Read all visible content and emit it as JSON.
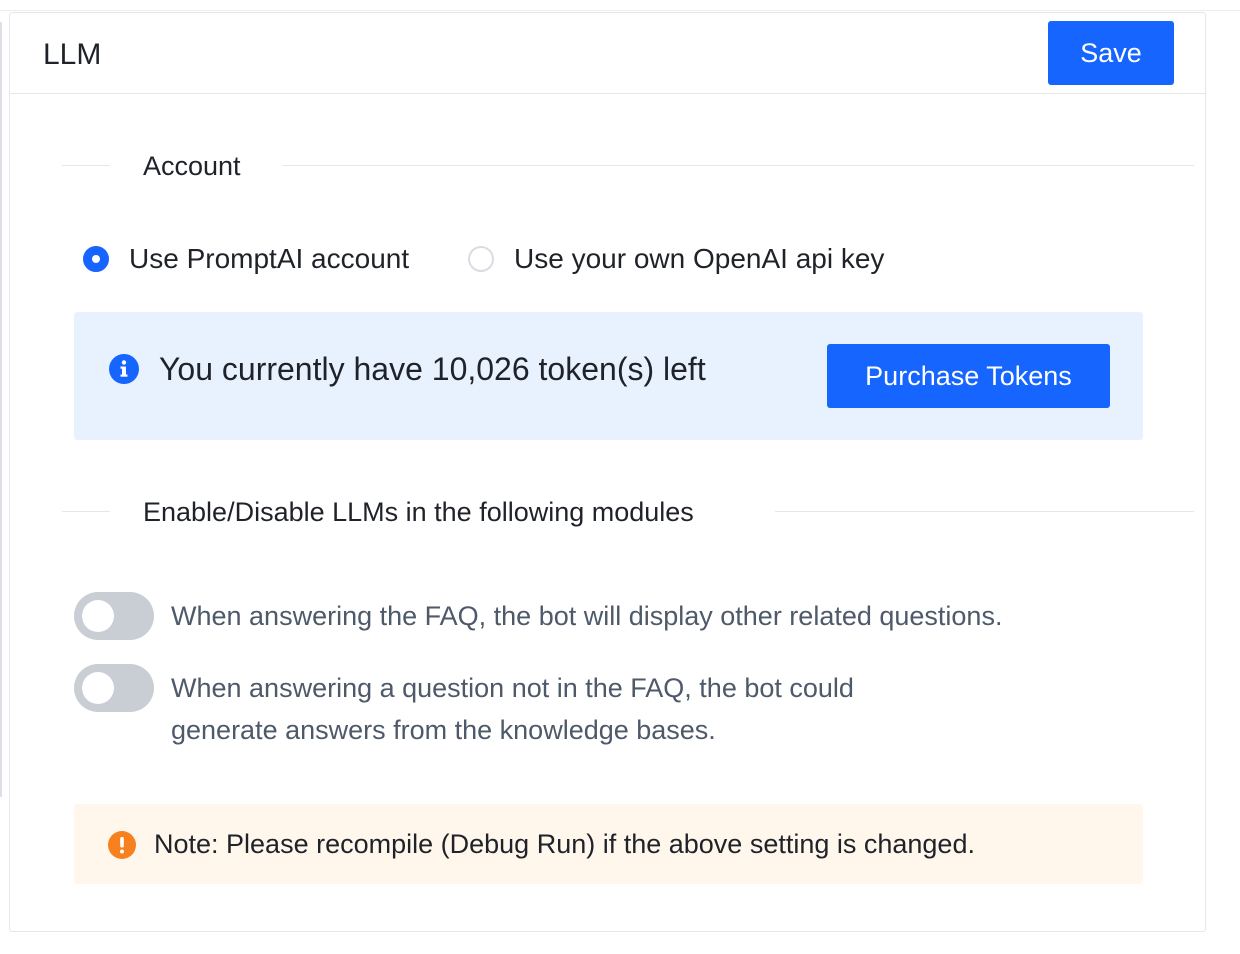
{
  "panel": {
    "title": "LLM",
    "save_label": "Save"
  },
  "account_section": {
    "heading": "Account",
    "options": [
      {
        "label": "Use PromptAI account",
        "selected": true
      },
      {
        "label": "Use your own OpenAI api key",
        "selected": false
      }
    ],
    "token_info": "You currently have 10,026 token(s) left",
    "purchase_label": "Purchase Tokens"
  },
  "modules_section": {
    "heading": "Enable/Disable LLMs in the following modules",
    "toggles": [
      {
        "label": "When answering the FAQ, the bot will display other related questions.",
        "enabled": false
      },
      {
        "label": "When answering a question not in the FAQ, the bot could generate answers from the knowledge bases.",
        "enabled": false
      }
    ]
  },
  "note": {
    "text": "Note: Please recompile (Debug Run) if the above setting is changed."
  },
  "icons": {
    "info": "info-circle-icon",
    "warning": "exclamation-circle-icon"
  },
  "colors": {
    "primary": "#1765ff",
    "info_bg": "#e8f2ff",
    "note_bg": "#fff7ec",
    "warning": "#f7801f",
    "switch_off": "#c9cdd4"
  }
}
